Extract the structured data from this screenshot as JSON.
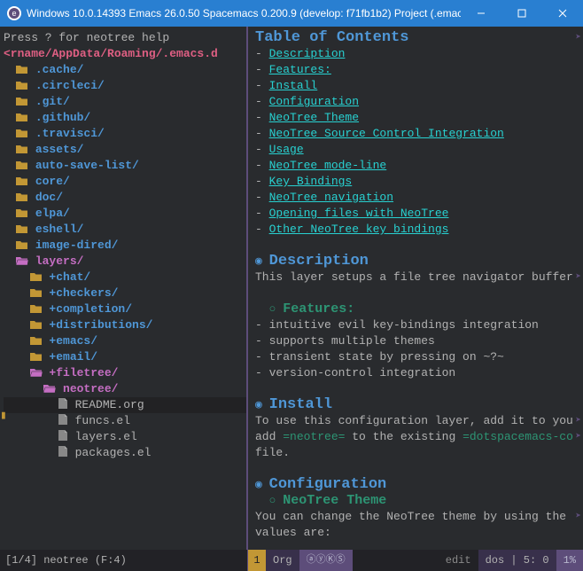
{
  "titlebar": {
    "text": "Windows 10.0.14393  Emacs 26.0.50  Spacemacs 0.200.9 (develop: f71fb1b2)  Project (.emac..."
  },
  "neotree": {
    "help": "Press ? for neotree help",
    "root": "<rname/AppData/Roaming/.emacs.d",
    "items": [
      {
        "depth": 0,
        "expanded": false,
        "type": "dir",
        "name": ".cache/"
      },
      {
        "depth": 0,
        "expanded": false,
        "type": "dir",
        "name": ".circleci/"
      },
      {
        "depth": 0,
        "expanded": false,
        "type": "dir",
        "name": ".git/"
      },
      {
        "depth": 0,
        "expanded": false,
        "type": "dir",
        "name": ".github/"
      },
      {
        "depth": 0,
        "expanded": false,
        "type": "dir",
        "name": ".travisci/"
      },
      {
        "depth": 0,
        "expanded": false,
        "type": "dir",
        "name": "assets/"
      },
      {
        "depth": 0,
        "expanded": false,
        "type": "dir",
        "name": "auto-save-list/"
      },
      {
        "depth": 0,
        "expanded": false,
        "type": "dir",
        "name": "core/"
      },
      {
        "depth": 0,
        "expanded": false,
        "type": "dir",
        "name": "doc/"
      },
      {
        "depth": 0,
        "expanded": false,
        "type": "dir",
        "name": "elpa/"
      },
      {
        "depth": 0,
        "expanded": false,
        "type": "dir",
        "name": "eshell/"
      },
      {
        "depth": 0,
        "expanded": false,
        "type": "dir",
        "name": "image-dired/"
      },
      {
        "depth": 0,
        "expanded": true,
        "type": "dir",
        "name": "layers/"
      },
      {
        "depth": 1,
        "expanded": false,
        "type": "dir",
        "name": "+chat/"
      },
      {
        "depth": 1,
        "expanded": false,
        "type": "dir",
        "name": "+checkers/"
      },
      {
        "depth": 1,
        "expanded": false,
        "type": "dir",
        "name": "+completion/"
      },
      {
        "depth": 1,
        "expanded": false,
        "type": "dir",
        "name": "+distributions/"
      },
      {
        "depth": 1,
        "expanded": false,
        "type": "dir",
        "name": "+emacs/"
      },
      {
        "depth": 1,
        "expanded": false,
        "type": "dir",
        "name": "+email/"
      },
      {
        "depth": 1,
        "expanded": true,
        "type": "dir",
        "name": "+filetree/"
      },
      {
        "depth": 2,
        "expanded": true,
        "type": "dir",
        "name": "neotree/"
      },
      {
        "depth": 3,
        "expanded": null,
        "type": "file",
        "name": "README.org",
        "current": true,
        "mark": true
      },
      {
        "depth": 3,
        "expanded": null,
        "type": "file",
        "name": "funcs.el"
      },
      {
        "depth": 3,
        "expanded": null,
        "type": "file",
        "name": "layers.el"
      },
      {
        "depth": 3,
        "expanded": null,
        "type": "file",
        "name": "packages.el"
      }
    ]
  },
  "content": {
    "toc_title": "Table of Contents",
    "toc": [
      {
        "d": 0,
        "t": "Description"
      },
      {
        "d": 1,
        "t": "Features:"
      },
      {
        "d": 0,
        "t": "Install"
      },
      {
        "d": 0,
        "t": "Configuration"
      },
      {
        "d": 1,
        "t": "NeoTree Theme"
      },
      {
        "d": 1,
        "t": "NeoTree Source Control Integration"
      },
      {
        "d": 0,
        "t": "Usage"
      },
      {
        "d": 1,
        "t": "NeoTree mode-line"
      },
      {
        "d": 0,
        "t": "Key Bindings"
      },
      {
        "d": 1,
        "t": "NeoTree navigation"
      },
      {
        "d": 1,
        "t": "Opening files with NeoTree"
      },
      {
        "d": 1,
        "t": "Other NeoTree key bindings"
      }
    ],
    "s_desc_h": "Description",
    "s_desc_p": "This layer setups a file tree navigator buffer",
    "s_feat_h": "Features:",
    "s_feat_items": [
      "intuitive evil key-bindings integration",
      "supports multiple themes",
      "transient state by pressing on ~?~",
      "version-control integration"
    ],
    "s_inst_h": "Install",
    "s_inst_p1a": "To use this configuration layer, add it to you",
    "s_inst_p2a": "add ",
    "s_inst_p2b": "=neotree=",
    "s_inst_p2c": " to the existing ",
    "s_inst_p2d": "=dotspacemacs-co",
    "s_inst_p3": "file.",
    "s_conf_h": "Configuration",
    "s_theme_h": "NeoTree Theme",
    "s_theme_p": "You can change the NeoTree theme by using the ",
    "s_theme_p2": "values are:"
  },
  "modeline": {
    "left": "[1/4] neotree (F:4)",
    "window_num": "1",
    "major": "Org",
    "circles": "ⓐⓨⓀⓈ",
    "state": "edit",
    "eol": "dos",
    "lc": "5: 0",
    "pct": "1%"
  },
  "icons": {
    "spacemacs": "e",
    "min": "—",
    "max": "□",
    "close": "✕"
  }
}
